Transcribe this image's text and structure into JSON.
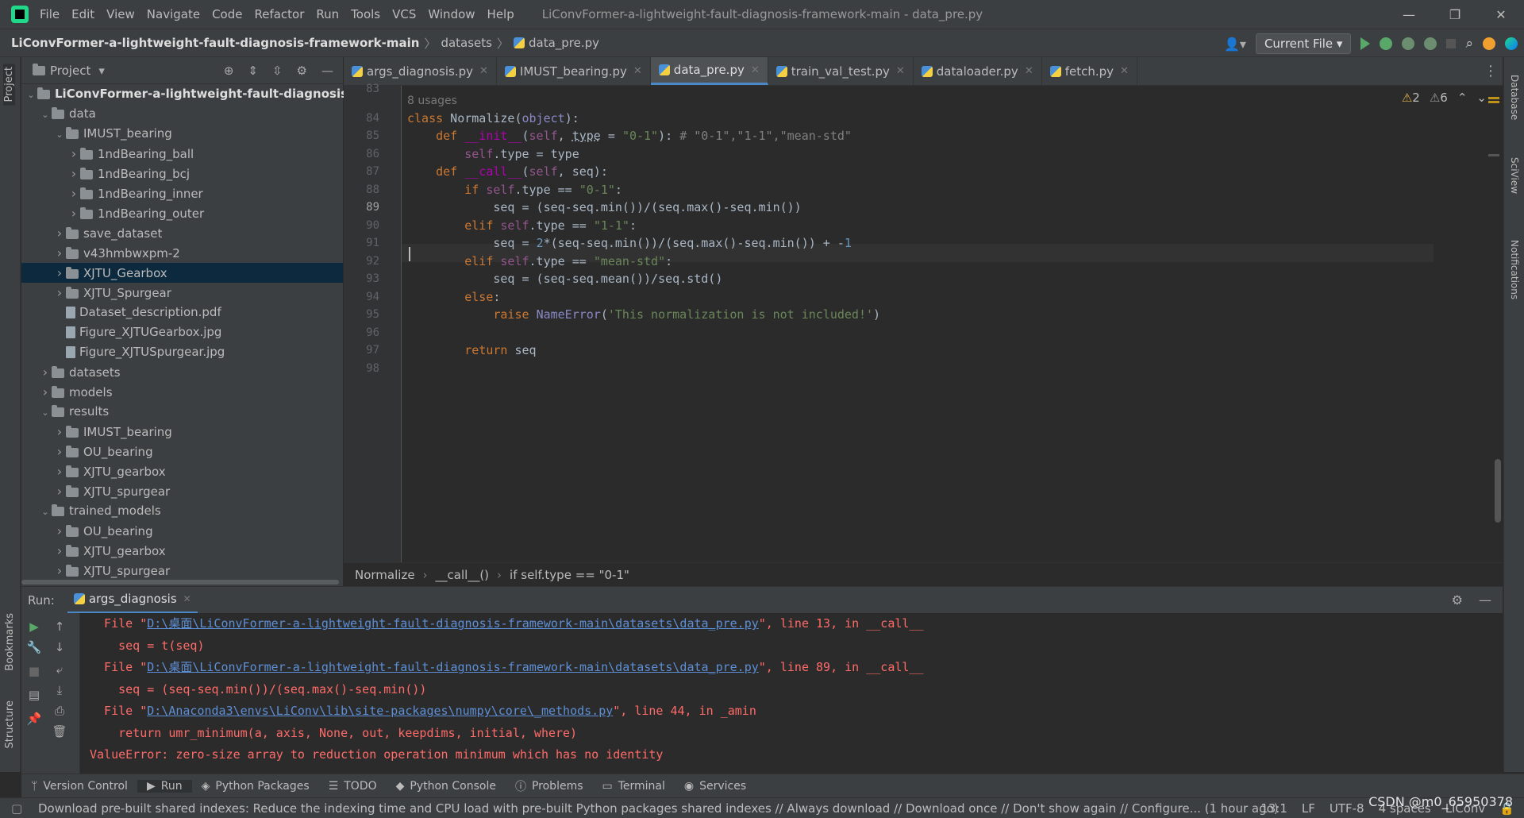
{
  "menubar": {
    "items": [
      "File",
      "Edit",
      "View",
      "Navigate",
      "Code",
      "Refactor",
      "Run",
      "Tools",
      "VCS",
      "Window",
      "Help"
    ],
    "window_title": "LiConvFormer-a-lightweight-fault-diagnosis-framework-main - data_pre.py"
  },
  "navbar": {
    "project": "LiConvFormer-a-lightweight-fault-diagnosis-framework-main",
    "folder": "datasets",
    "file": "data_pre.py",
    "run_config": "Current File"
  },
  "project_panel": {
    "title": "Project",
    "tree": [
      {
        "label": "LiConvFormer-a-lightweight-fault-diagnosis-fr",
        "depth": 0,
        "expanded": true,
        "type": "folder",
        "bold": true
      },
      {
        "label": "data",
        "depth": 1,
        "expanded": true,
        "type": "folder"
      },
      {
        "label": "IMUST_bearing",
        "depth": 2,
        "expanded": true,
        "type": "folder"
      },
      {
        "label": "1ndBearing_ball",
        "depth": 3,
        "expanded": false,
        "type": "folder"
      },
      {
        "label": "1ndBearing_bcj",
        "depth": 3,
        "expanded": false,
        "type": "folder"
      },
      {
        "label": "1ndBearing_inner",
        "depth": 3,
        "expanded": false,
        "type": "folder"
      },
      {
        "label": "1ndBearing_outer",
        "depth": 3,
        "expanded": false,
        "type": "folder"
      },
      {
        "label": "save_dataset",
        "depth": 2,
        "expanded": false,
        "type": "folder"
      },
      {
        "label": "v43hmbwxpm-2",
        "depth": 2,
        "expanded": false,
        "type": "folder"
      },
      {
        "label": "XJTU_Gearbox",
        "depth": 2,
        "expanded": false,
        "type": "folder",
        "selected": true
      },
      {
        "label": "XJTU_Spurgear",
        "depth": 2,
        "expanded": false,
        "type": "folder"
      },
      {
        "label": "Dataset_description.pdf",
        "depth": 2,
        "type": "file"
      },
      {
        "label": "Figure_XJTUGearbox.jpg",
        "depth": 2,
        "type": "file"
      },
      {
        "label": "Figure_XJTUSpurgear.jpg",
        "depth": 2,
        "type": "file"
      },
      {
        "label": "datasets",
        "depth": 1,
        "expanded": false,
        "type": "folder"
      },
      {
        "label": "models",
        "depth": 1,
        "expanded": false,
        "type": "folder"
      },
      {
        "label": "results",
        "depth": 1,
        "expanded": true,
        "type": "folder"
      },
      {
        "label": "IMUST_bearing",
        "depth": 2,
        "expanded": false,
        "type": "folder"
      },
      {
        "label": "OU_bearing",
        "depth": 2,
        "expanded": false,
        "type": "folder"
      },
      {
        "label": "XJTU_gearbox",
        "depth": 2,
        "expanded": false,
        "type": "folder"
      },
      {
        "label": "XJTU_spurgear",
        "depth": 2,
        "expanded": false,
        "type": "folder"
      },
      {
        "label": "trained_models",
        "depth": 1,
        "expanded": true,
        "type": "folder"
      },
      {
        "label": "OU_bearing",
        "depth": 2,
        "expanded": false,
        "type": "folder"
      },
      {
        "label": "XJTU_gearbox",
        "depth": 2,
        "expanded": false,
        "type": "folder"
      },
      {
        "label": "XJTU_spurgear",
        "depth": 2,
        "expanded": false,
        "type": "folder"
      }
    ]
  },
  "tabs": [
    {
      "label": "args_diagnosis.py",
      "active": false
    },
    {
      "label": "IMUST_bearing.py",
      "active": false
    },
    {
      "label": "data_pre.py",
      "active": true
    },
    {
      "label": "train_val_test.py",
      "active": false
    },
    {
      "label": "dataloader.py",
      "active": false
    },
    {
      "label": "fetch.py",
      "active": false
    }
  ],
  "editor": {
    "usages_hint": "8 usages",
    "warnings": "2",
    "weak_warnings": "6",
    "line_numbers": [
      "83",
      "84",
      "85",
      "86",
      "87",
      "88",
      "89",
      "90",
      "91",
      "92",
      "93",
      "94",
      "95",
      "96",
      "97",
      "98"
    ],
    "current_line": "89"
  },
  "code_breadcrumbs": [
    "Normalize",
    "__call__()",
    "if self.type == \"0-1\""
  ],
  "run_panel": {
    "label": "Run:",
    "tab": "args_diagnosis",
    "lines": [
      {
        "pre": "  File \"",
        "link": "D:\\桌面\\LiConvFormer-a-lightweight-fault-diagnosis-framework-main\\datasets\\data_pre.py",
        "post": "\", line 13, in __call__"
      },
      {
        "text": "    seq = t(seq)"
      },
      {
        "pre": "  File \"",
        "link": "D:\\桌面\\LiConvFormer-a-lightweight-fault-diagnosis-framework-main\\datasets\\data_pre.py",
        "post": "\", line 89, in __call__"
      },
      {
        "text": "    seq = (seq-seq.min())/(seq.max()-seq.min())"
      },
      {
        "pre": "  File \"",
        "link": "D:\\Anaconda3\\envs\\LiConv\\lib\\site-packages\\numpy\\core\\_methods.py",
        "post": "\", line 44, in _amin"
      },
      {
        "text": "    return umr_minimum(a, axis, None, out, keepdims, initial, where)"
      },
      {
        "text": "ValueError: zero-size array to reduction operation minimum which has no identity"
      }
    ]
  },
  "bottom_tabs": [
    "Version Control",
    "Run",
    "Python Packages",
    "TODO",
    "Python Console",
    "Problems",
    "Terminal",
    "Services"
  ],
  "statusbar": {
    "message": "Download pre-built shared indexes: Reduce the indexing time and CPU load with pre-built Python packages shared indexes // Always download // Download once // Don't show again // Configure... (1 hour ago)",
    "position": "13:1",
    "line_sep": "LF",
    "encoding": "UTF-8",
    "indent": "4 spaces",
    "interpreter": "LiConv"
  },
  "side_labels": {
    "left_top": "Project",
    "left_bookmarks": "Bookmarks",
    "left_structure": "Structure",
    "right_db": "Database",
    "right_sciview": "SciView",
    "right_notif": "Notifications"
  },
  "watermark": "CSDN @m0_65950378"
}
